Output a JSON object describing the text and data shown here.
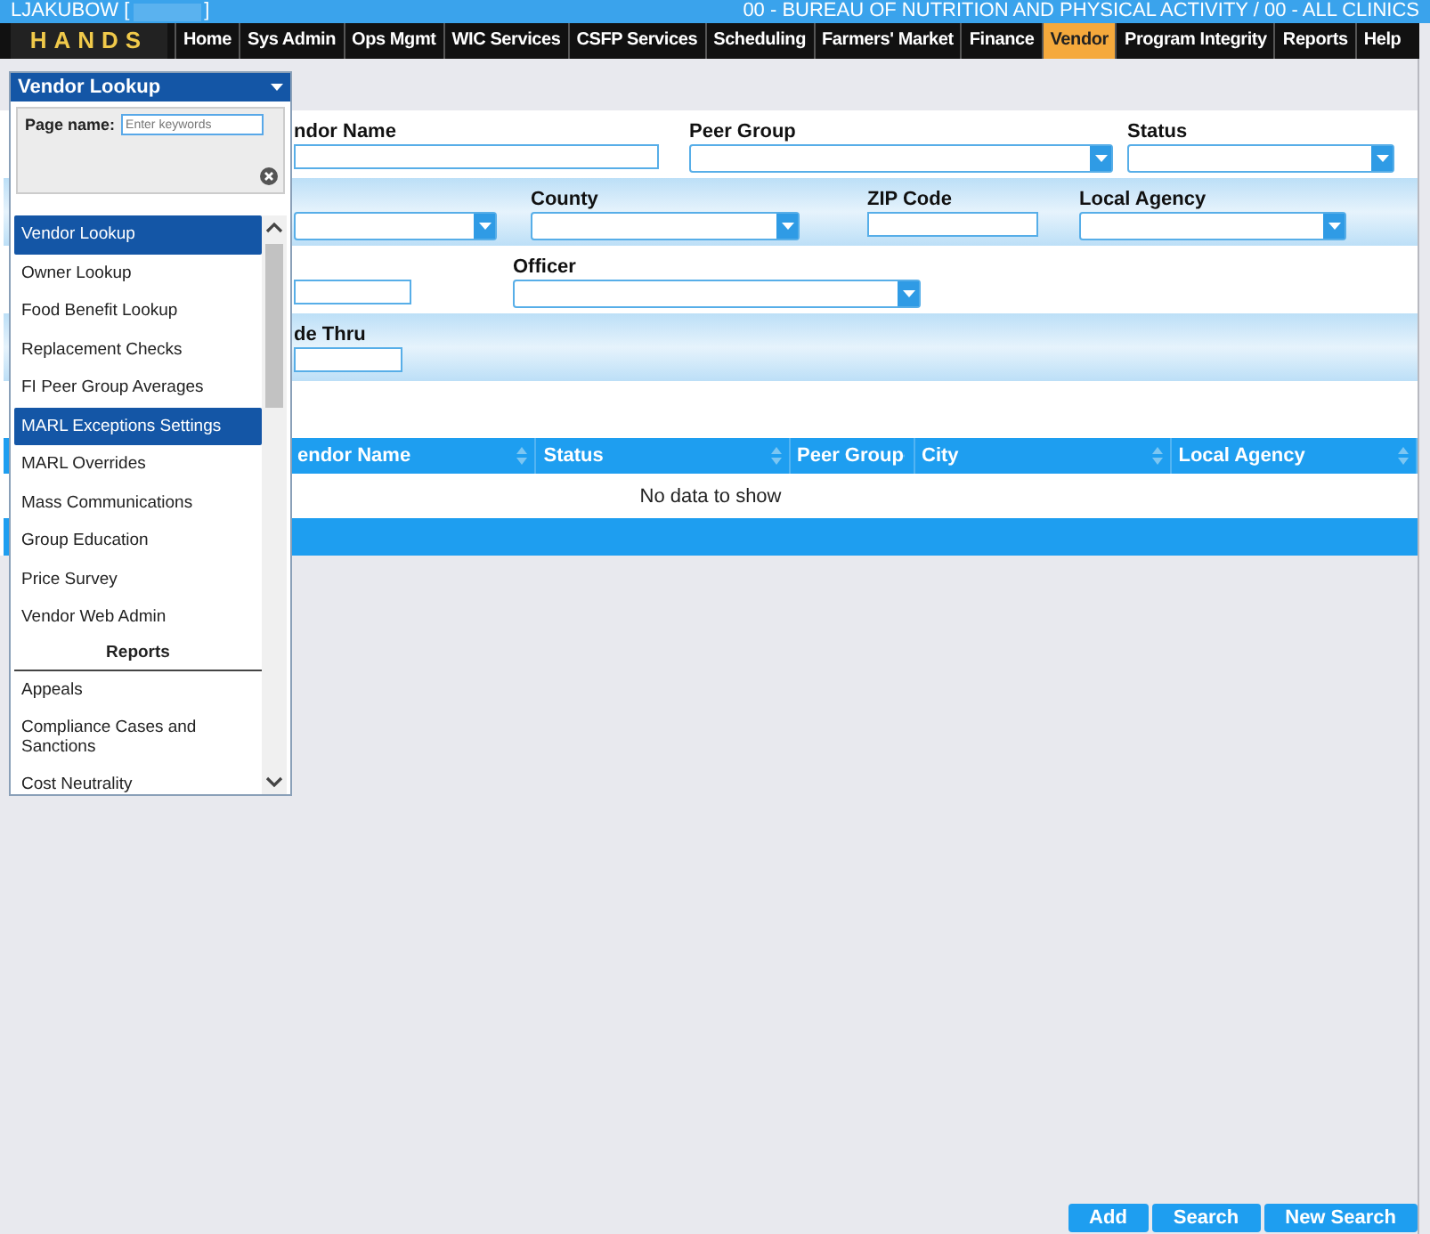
{
  "top_bar": {
    "user": "LJAKUBOW [",
    "user_end": "]",
    "organization": "00 - BUREAU OF NUTRITION AND PHYSICAL ACTIVITY / 00 - ALL CLINICS"
  },
  "logo": {
    "text": "HANDS"
  },
  "nav_tabs": [
    {
      "label": "Home",
      "selected": false
    },
    {
      "label": "Sys Admin",
      "selected": false
    },
    {
      "label": "Ops Mgmt",
      "selected": false
    },
    {
      "label": "WIC Services",
      "selected": false
    },
    {
      "label": "CSFP Services",
      "selected": false
    },
    {
      "label": "Scheduling",
      "selected": false
    },
    {
      "label": "Farmers' Market",
      "selected": false
    },
    {
      "label": "Finance",
      "selected": false
    },
    {
      "label": "Vendor",
      "selected": true
    },
    {
      "label": "Program Integrity",
      "selected": false
    },
    {
      "label": "Reports",
      "selected": false
    },
    {
      "label": "Help",
      "selected": false
    }
  ],
  "page_menu": {
    "title": "Vendor Lookup",
    "search_label": "Page name:",
    "search_placeholder": "Enter keywords",
    "items": [
      {
        "kind": "link",
        "label": "Vendor Lookup",
        "selected": true
      },
      {
        "kind": "link",
        "label": "Owner Lookup",
        "selected": false
      },
      {
        "kind": "link",
        "label": "Food Benefit Lookup",
        "selected": false
      },
      {
        "kind": "link",
        "label": "Replacement Checks",
        "selected": false
      },
      {
        "kind": "link",
        "label": "FI Peer Group Averages",
        "selected": false
      },
      {
        "kind": "link",
        "label": "MARL Exceptions Settings",
        "selected": true
      },
      {
        "kind": "link",
        "label": "MARL Overrides",
        "selected": false
      },
      {
        "kind": "link",
        "label": "Mass Communications",
        "selected": false
      },
      {
        "kind": "link",
        "label": "Group Education",
        "selected": false
      },
      {
        "kind": "link",
        "label": "Price Survey",
        "selected": false
      },
      {
        "kind": "link",
        "label": "Vendor Web Admin",
        "selected": false
      },
      {
        "kind": "header",
        "label": "Reports"
      },
      {
        "kind": "link",
        "label": "Appeals",
        "selected": false
      },
      {
        "kind": "link",
        "label": "Compliance Cases and Sanctions",
        "selected": false
      },
      {
        "kind": "link",
        "label": "Cost Neutrality",
        "selected": false
      }
    ]
  },
  "form": {
    "rows": [
      {
        "fields": [
          {
            "label": "ndor Name",
            "kind": "text"
          },
          {
            "label": "Peer Group",
            "kind": "select"
          },
          {
            "label": "Status",
            "kind": "select"
          }
        ]
      },
      {
        "fields": [
          {
            "kind": "select"
          },
          {
            "label": "County",
            "kind": "select"
          },
          {
            "label": "ZIP Code",
            "kind": "text"
          },
          {
            "label": "Local Agency",
            "kind": "select"
          }
        ]
      },
      {
        "fields": [
          {
            "kind": "text"
          },
          {
            "label": "Officer",
            "kind": "select"
          }
        ]
      },
      {
        "fields": [
          {
            "label": "de Thru",
            "kind": "text"
          }
        ]
      }
    ]
  },
  "table": {
    "columns": [
      "endor Name",
      "Status",
      "Peer Group",
      "City",
      "Local Agency"
    ],
    "empty_message": "No data to show"
  },
  "buttons": [
    "Add",
    "Search",
    "New Search"
  ]
}
